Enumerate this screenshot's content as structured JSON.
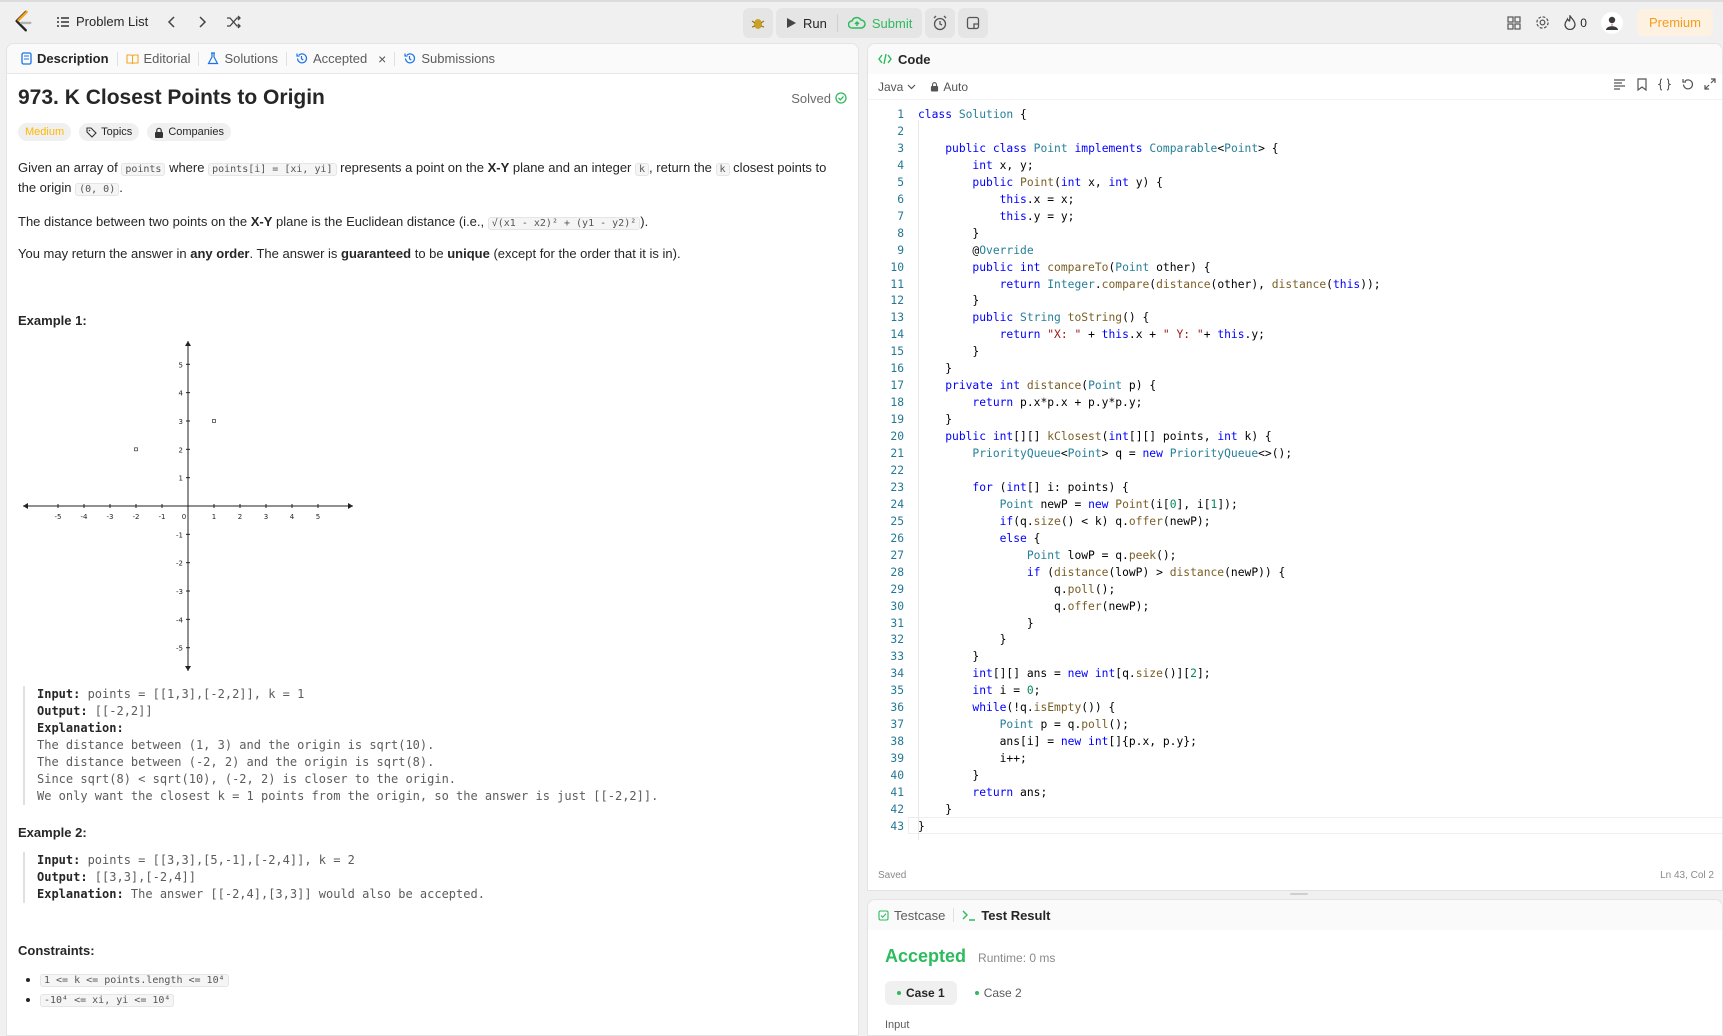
{
  "nav": {
    "problem_list": "Problem List",
    "run": "Run",
    "submit": "Submit",
    "streak_count": "0",
    "premium": "Premium"
  },
  "tabs": [
    {
      "label": "Description"
    },
    {
      "label": "Editorial"
    },
    {
      "label": "Solutions"
    },
    {
      "label": "Accepted"
    },
    {
      "label": "Submissions"
    }
  ],
  "problem": {
    "title": "973. K Closest Points to Origin",
    "status": "Solved",
    "difficulty": "Medium",
    "topics": "Topics",
    "companies": "Companies",
    "p1_a": "Given an array of ",
    "p1_code1": "points",
    "p1_b": " where ",
    "p1_code2": "points[i] = [xi, yi]",
    "p1_c": " represents a point on the ",
    "p1_bold": "X-Y",
    "p1_d": " plane and an integer ",
    "p1_code3": "k",
    "p1_e": ", return the ",
    "p1_code4": "k",
    "p1_f": " closest points to the origin ",
    "p1_code5": "(0, 0)",
    "p1_g": ".",
    "p2_a": "The distance between two points on the ",
    "p2_bold": "X-Y",
    "p2_b": " plane is the Euclidean distance (i.e., ",
    "p2_code": "√(x1 - x2)² + (y1 - y2)²",
    "p2_c": ").",
    "p3_a": "You may return the answer in ",
    "p3_b1": "any order",
    "p3_b": ". The answer is ",
    "p3_b2": "guaranteed",
    "p3_c": " to be ",
    "p3_b3": "unique",
    "p3_d": " (except for the order that it is in).",
    "example1_title": "Example 1:",
    "example1": {
      "input_label": "Input:",
      "input": " points = [[1,3],[-2,2]], k = 1",
      "output_label": "Output:",
      "output": " [[-2,2]]",
      "expl_label": "Explanation:",
      "expl_lines": [
        "The distance between (1, 3) and the origin is sqrt(10).",
        "The distance between (-2, 2) and the origin is sqrt(8).",
        "Since sqrt(8) < sqrt(10), (-2, 2) is closer to the origin.",
        "We only want the closest k = 1 points from the origin, so the answer is just [[-2,2]]."
      ]
    },
    "example2_title": "Example 2:",
    "example2": {
      "input_label": "Input:",
      "input": " points = [[3,3],[5,-1],[-2,4]], k = 2",
      "output_label": "Output:",
      "output": " [[3,3],[-2,4]]",
      "expl_label": "Explanation:",
      "expl": " The answer [[-2,4],[3,3]] would also be accepted."
    },
    "constraints_title": "Constraints:",
    "constraints": [
      "1 <= k <= points.length <= 10⁴",
      "-10⁴ <= xi, yi <= 10⁴"
    ],
    "graph_x_ticks": [
      "-5",
      "-4",
      "-3",
      "-2",
      "-1",
      "0",
      "1",
      "2",
      "3",
      "4",
      "5"
    ],
    "graph_y_ticks": [
      "5",
      "4",
      "3",
      "2",
      "1",
      "-1",
      "-2",
      "-3",
      "-4",
      "-5"
    ]
  },
  "code_panel": {
    "title": "Code",
    "language": "Java",
    "mode": "Auto",
    "saved": "Saved",
    "cursor": "Ln 43, Col 2"
  },
  "result_panel": {
    "testcase_tab": "Testcase",
    "result_tab": "Test Result",
    "status": "Accepted",
    "runtime": "Runtime: 0 ms",
    "case1": "Case 1",
    "case2": "Case 2",
    "input_label": "Input"
  },
  "colors": {
    "accent_green": "#2cbb5d",
    "medium": "#ffb800",
    "premium": "#f59d1b"
  }
}
